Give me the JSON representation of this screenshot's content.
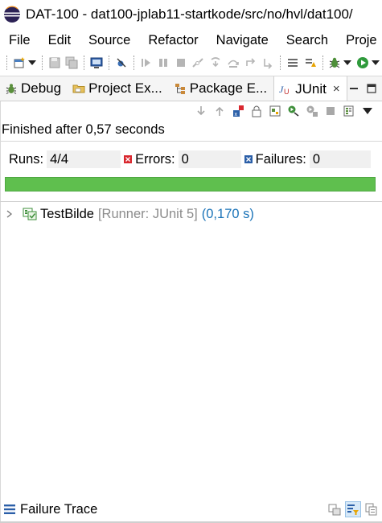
{
  "window": {
    "title": "DAT-100 - dat100-jplab11-startkode/src/no/hvl/dat100/"
  },
  "menu": {
    "items": [
      "File",
      "Edit",
      "Source",
      "Refactor",
      "Navigate",
      "Search",
      "Proje"
    ]
  },
  "toolbar": {
    "icons": [
      "new-wizard-icon",
      "save-icon",
      "save-all-icon",
      "terminal-icon",
      "skip-breakpoints-icon",
      "resume-icon",
      "suspend-icon",
      "terminate-icon",
      "disconnect-icon",
      "step-into-icon",
      "step-over-icon",
      "step-return-icon",
      "drop-to-frame-icon",
      "use-step-filters-icon",
      "debug-icon",
      "run-icon"
    ]
  },
  "tabs": [
    {
      "label": "Debug",
      "icon": "debug-bug-icon"
    },
    {
      "label": "Project Ex...",
      "icon": "folder-icon"
    },
    {
      "label": "Package E...",
      "icon": "package-explorer-icon"
    },
    {
      "label": "JUnit",
      "icon": "junit-icon",
      "active": true,
      "close": "×"
    }
  ],
  "junit": {
    "status": "Finished after 0,57 seconds",
    "runs_label": "Runs:",
    "runs_value": "4/4",
    "errors_label": "Errors:",
    "errors_value": "0",
    "failures_label": "Failures:",
    "failures_value": "0",
    "progress_fraction": 1.0,
    "progress_color": "#5fbf4e",
    "tree": {
      "name": "TestBilde",
      "runner": "[Runner: JUnit 5]",
      "time": "(0,170 s)"
    },
    "failure_trace_label": "Failure Trace"
  },
  "colors": {
    "time_text": "#1a73b8",
    "runner_text": "#8c8c8c",
    "success": "#5fbf4e",
    "error_red": "#d9282f",
    "failure_blue": "#2b5fa8"
  }
}
